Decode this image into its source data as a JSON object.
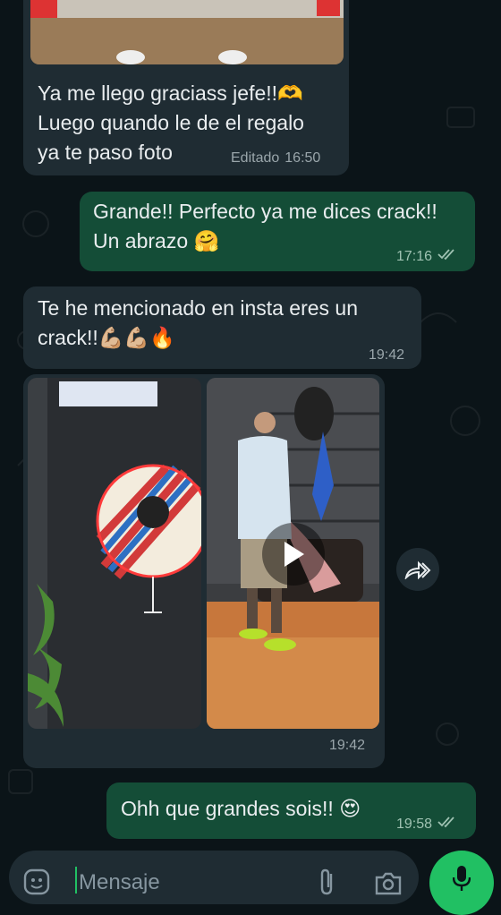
{
  "messages": [
    {
      "id": "m1",
      "dir": "in",
      "text": "Ya me llego graciass jefe!!🫶\nLuego quando le de el regalo\nya te paso foto",
      "edited": "Editado",
      "time": "16:50"
    },
    {
      "id": "m2",
      "dir": "out",
      "text": "Grande!! Perfecto ya me dices crack!!\nUn abrazo 🤗",
      "time": "17:16"
    },
    {
      "id": "m3",
      "dir": "in",
      "text": "Te he mencionado en insta eres un\ncrack!!💪🏼💪🏼🔥",
      "time": "19:42"
    },
    {
      "id": "m4",
      "dir": "in",
      "type": "media",
      "time": "19:42"
    },
    {
      "id": "m5",
      "dir": "out",
      "text": "Ohh que grandes sois!! 😍",
      "time": "19:58"
    }
  ],
  "composer": {
    "placeholder": "Mensaje"
  },
  "colors": {
    "incoming": "#1f2c33",
    "outgoing": "#144d37",
    "accent": "#21c063",
    "background": "#0b1418"
  },
  "icons": [
    "double-check-icon",
    "play-icon",
    "forward-icon",
    "sticker-icon",
    "attach-icon",
    "camera-icon",
    "mic-icon"
  ]
}
